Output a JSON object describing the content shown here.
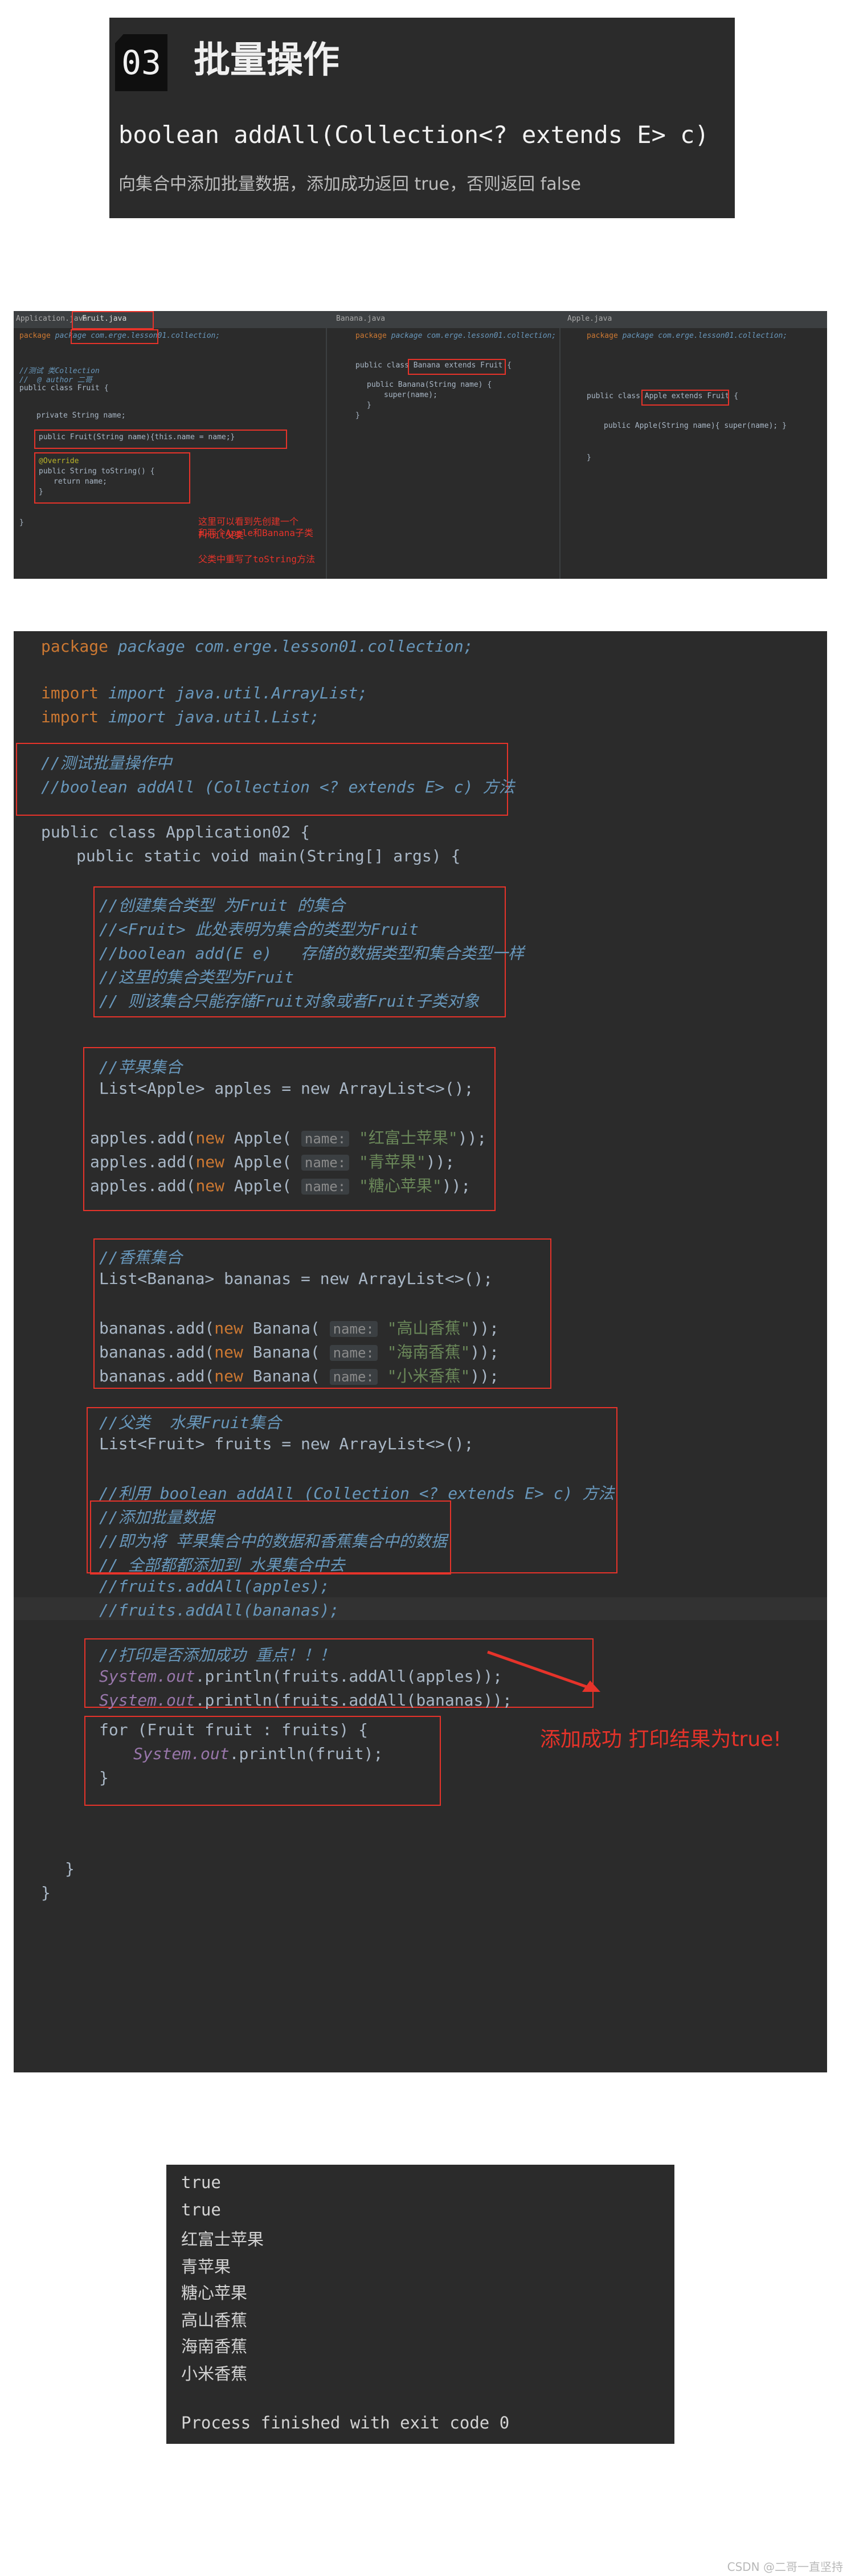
{
  "banner": {
    "number": "03",
    "title": "批量操作",
    "signature": "boolean addAll(Collection<? extends E> c)",
    "description": "向集合中添加批量数据，添加成功返回 true，否则返回 false"
  },
  "ide_top": {
    "tabs": [
      "Application.java",
      "Fruit.java",
      "Banana.java",
      "Apple.java"
    ],
    "fruit_pane": {
      "line1": "package com.erge.lesson01.collection;",
      "comment1": "//测试 类Collection",
      "comment2": "//  @ author 二哥",
      "line_class": "public class Fruit {",
      "line_field": "private String name;",
      "line_ctor": "public Fruit(String name){this.name = name;}",
      "line_override": "@Override",
      "line_tostring": "public String toString() {",
      "line_return": "return name;",
      "line_close": "}",
      "line_close2": "}"
    },
    "banana_pane": {
      "line1": "package com.erge.lesson01.collection;",
      "line_class": "public class Banana extends Fruit {",
      "line_ctor": "public Banana(String name) {",
      "line_super": "super(name);",
      "line_close": "}",
      "line_close2": "}"
    },
    "apple_pane": {
      "line1": "package com.erge.lesson01.collection;",
      "line_class": "public class Apple extends Fruit {",
      "line_ctor": "public Apple(String name){ super(name); }",
      "line_close": "}"
    },
    "notes": {
      "note1": "这里可以看到先创建一个Fruit父类",
      "note2": "和两个Apple和Banana子类",
      "note3": "父类中重写了toString方法"
    }
  },
  "code": {
    "l1": "package com.erge.lesson01.collection;",
    "l2": "import java.util.ArrayList;",
    "l3": "import java.util.List;",
    "l4": "//测试批量操作中",
    "l5": "//boolean addAll (Collection <? extends E> c) 方法",
    "l6": "public class Application02 {",
    "l7": "public static void main(String[] args) {",
    "c1": "//创建集合类型 为Fruit 的集合",
    "c2": "//<Fruit> 此处表明为集合的类型为Fruit",
    "c3": "//boolean add(E e)   存储的数据类型和集合类型一样",
    "c4": "//这里的集合类型为Fruit",
    "c5": "// 则该集合只能存储Fruit对象或者Fruit子类对象",
    "a0": "//苹果集合",
    "a1": "List<Apple> apples = new ArrayList<>();",
    "a2": "\"红富士苹果\"",
    "a3": "\"青苹果\"",
    "a4": "\"糖心苹果\"",
    "b0": "//香蕉集合",
    "b1": "List<Banana> bananas = new ArrayList<>();",
    "b2": "\"高山香蕉\"",
    "b3": "\"海南香蕉\"",
    "b4": "\"小米香蕉\"",
    "f0": "//父类  水果Fruit集合",
    "f1": "List<Fruit> fruits = new ArrayList<>();",
    "f2": "//利用 boolean addAll (Collection <? extends E> c) 方法",
    "f3": "//添加批量数据",
    "f4": "//即为将 苹果集合中的数据和香蕉集合中的数据",
    "f5": "// 全部都都添加到 水果集合中去",
    "f6": "//fruits.addAll(apples);",
    "f7": "//fruits.addAll(bananas);",
    "p0": "//打印是否添加成功 重点！！！",
    "p1": "System.out.println(fruits.addAll(apples));",
    "p2": "System.out.println(fruits.addAll(bananas));",
    "r1": "for (Fruit fruit : fruits) {",
    "r2": "System.out.println(fruit);",
    "r3": "}",
    "close1": "}",
    "close2": "}",
    "hint_name": "name:",
    "annotation": "添加成功  打印结果为true!"
  },
  "output": {
    "lines": [
      "true",
      "true",
      "红富士苹果",
      "青苹果",
      "糖心苹果",
      "高山香蕉",
      "海南香蕉",
      "小米香蕉",
      "",
      "Process finished with exit code 0"
    ]
  },
  "footer": "CSDN @二哥一直坚持",
  "colors": {
    "editor_bg": "#2b2b2b",
    "highlight_red": "#e6332a",
    "keyword": "#cc7832",
    "string": "#6a8759",
    "comment": "#6897bb"
  }
}
